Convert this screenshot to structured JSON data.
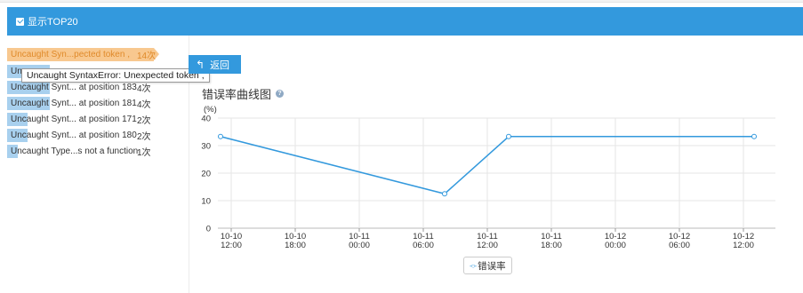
{
  "header": {
    "checkbox_label": "显示TOP20"
  },
  "error_list": [
    {
      "label": "Uncaught Syn...pected token ,",
      "count": "14次",
      "fill": 1.0,
      "active": true
    },
    {
      "label": "Unc",
      "count": "",
      "fill": 0.29
    },
    {
      "label": "Uncaught Synt... at position 183",
      "count": "4次",
      "fill": 0.29
    },
    {
      "label": "Uncaught Synt... at position 181",
      "count": "4次",
      "fill": 0.29
    },
    {
      "label": "Uncaught Synt... at position 171",
      "count": "2次",
      "fill": 0.14
    },
    {
      "label": "Uncaught Synt... at position 180",
      "count": "2次",
      "fill": 0.14
    },
    {
      "label": "Uncaught Type...s not a function",
      "count": "1次",
      "fill": 0.07
    }
  ],
  "tooltip": {
    "text": "Uncaught SyntaxError: Unexpected token ,"
  },
  "back_button": {
    "label": "返回"
  },
  "chart": {
    "title": "错误率曲线图",
    "help_icon": "question-icon"
  },
  "chart_data": {
    "type": "line",
    "ylabel": "(%)",
    "ylim": [
      0,
      40
    ],
    "yticks": [
      "0",
      "10",
      "20",
      "30",
      "40"
    ],
    "xticks": [
      [
        "10-10",
        "12:00"
      ],
      [
        "10-10",
        "18:00"
      ],
      [
        "10-11",
        "00:00"
      ],
      [
        "10-11",
        "06:00"
      ],
      [
        "10-11",
        "12:00"
      ],
      [
        "10-11",
        "18:00"
      ],
      [
        "10-12",
        "00:00"
      ],
      [
        "10-12",
        "06:00"
      ],
      [
        "10-12",
        "12:00"
      ]
    ],
    "series": [
      {
        "name": "错误率",
        "color": "#3399dd",
        "points": [
          {
            "x": "10-10 11:00",
            "y": 33.3
          },
          {
            "x": "10-11 08:00",
            "y": 12.5
          },
          {
            "x": "10-11 14:00",
            "y": 33.3
          },
          {
            "x": "10-12 13:00",
            "y": 33.3
          }
        ]
      }
    ],
    "grid": true,
    "legend": "bottom-center"
  }
}
